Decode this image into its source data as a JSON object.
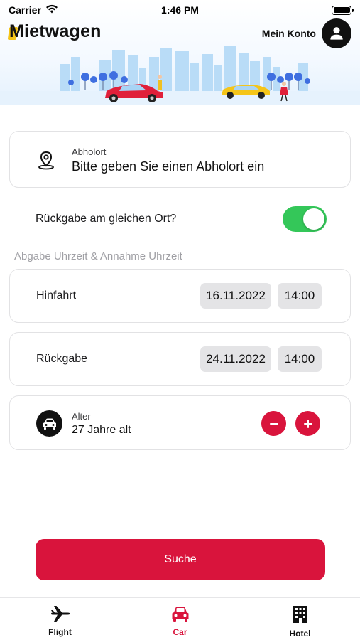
{
  "status_bar": {
    "carrier": "Carrier",
    "time": "1:46 PM"
  },
  "header": {
    "title": "Mietwagen",
    "account_label": "Mein Konto"
  },
  "pickup": {
    "label": "Abholort",
    "placeholder": "Bitte geben Sie einen Abholort ein",
    "icon": "location-pin-icon"
  },
  "same_return": {
    "label": "Rückgabe am gleichen Ort?",
    "enabled": true
  },
  "times_section_label": "Abgabe Uhrzeit & Annahme Uhrzeit",
  "outbound": {
    "label": "Hinfahrt",
    "date": "16.11.2022",
    "time": "14:00"
  },
  "return_trip": {
    "label": "Rückgabe",
    "date": "24.11.2022",
    "time": "14:00"
  },
  "age": {
    "label": "Alter",
    "value": "27 Jahre alt",
    "icon": "car-icon"
  },
  "search_button": "Suche",
  "tabs": [
    {
      "label": "Flight",
      "icon": "airplane-icon",
      "active": false
    },
    {
      "label": "Car",
      "icon": "car-icon",
      "active": true
    },
    {
      "label": "Hotel",
      "icon": "building-icon",
      "active": false
    }
  ],
  "colors": {
    "accent": "#d9143c",
    "toggle_on": "#34c759",
    "chip_bg": "#e4e4e6",
    "section_label": "#a0a0a5"
  }
}
